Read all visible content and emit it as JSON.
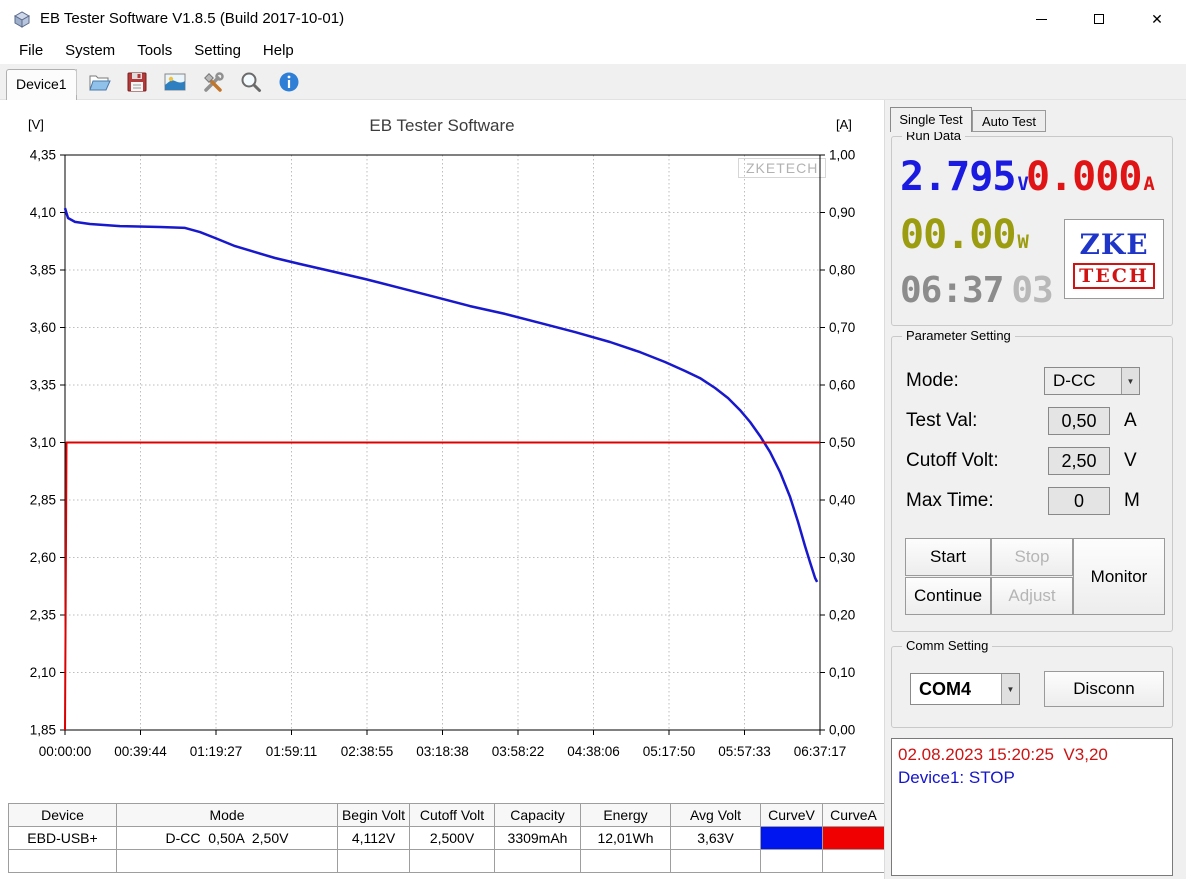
{
  "window": {
    "title": "EB Tester Software V1.8.5 (Build 2017-10-01)",
    "control_icons": [
      "minimize-icon",
      "maximize-icon",
      "close-icon"
    ]
  },
  "menu": {
    "items": [
      "File",
      "System",
      "Tools",
      "Setting",
      "Help"
    ]
  },
  "toolbar": {
    "device_tab": "Device1",
    "icons": [
      "open-file-icon",
      "save-icon",
      "export-image-icon",
      "tools-icon",
      "zoom-icon",
      "info-icon"
    ]
  },
  "chart_data": {
    "type": "line",
    "title": "EB Tester Software",
    "watermark": "ZKETECH",
    "xlim": [
      0,
      6.6214
    ],
    "x_ticks": [
      "00:00:00",
      "00:39:44",
      "01:19:27",
      "01:59:11",
      "02:38:55",
      "03:18:38",
      "03:58:22",
      "04:38:06",
      "05:17:50",
      "05:57:33",
      "06:37:17"
    ],
    "left_axis": {
      "unit": "[V]",
      "lim": [
        1.85,
        4.35
      ],
      "ticks": [
        "4,35",
        "4,10",
        "3,85",
        "3,60",
        "3,35",
        "3,10",
        "2,85",
        "2,60",
        "2,35",
        "2,10",
        "1,85"
      ]
    },
    "right_axis": {
      "unit": "[A]",
      "lim": [
        0.0,
        1.0
      ],
      "ticks": [
        "1,00",
        "0,90",
        "0,80",
        "0,70",
        "0,60",
        "0,50",
        "0,40",
        "0,30",
        "0,20",
        "0,10",
        "0,00"
      ]
    },
    "grid": "dotted",
    "series": [
      {
        "name": "Voltage",
        "axis": "left",
        "color": "#1818cc",
        "x": [
          0,
          0.026,
          0.088,
          0.219,
          0.482,
          0.833,
          1.052,
          1.184,
          1.316,
          1.491,
          1.666,
          1.842,
          2.061,
          2.324,
          2.631,
          2.938,
          3.245,
          3.552,
          3.859,
          4.166,
          4.473,
          4.78,
          5.043,
          5.262,
          5.438,
          5.569,
          5.701,
          5.815,
          5.92,
          6.008,
          6.096,
          6.183,
          6.271,
          6.359,
          6.429,
          6.49,
          6.534,
          6.578,
          6.596
        ],
        "y": [
          4.119,
          4.076,
          4.059,
          4.05,
          4.041,
          4.037,
          4.033,
          4.015,
          3.989,
          3.954,
          3.928,
          3.902,
          3.876,
          3.846,
          3.811,
          3.772,
          3.733,
          3.693,
          3.659,
          3.62,
          3.58,
          3.537,
          3.493,
          3.45,
          3.411,
          3.38,
          3.337,
          3.293,
          3.241,
          3.189,
          3.128,
          3.059,
          2.972,
          2.863,
          2.754,
          2.65,
          2.58,
          2.511,
          2.494
        ]
      },
      {
        "name": "Current",
        "axis": "right",
        "color": "#dd0000",
        "x": [
          0,
          0.013,
          6.6214
        ],
        "y": [
          0,
          0.5,
          0.5
        ]
      }
    ]
  },
  "side_panel": {
    "tabs": [
      {
        "label": "Single Test",
        "active": true
      },
      {
        "label": "Auto Test",
        "active": false
      }
    ],
    "run_data": {
      "label": "Run Data",
      "voltage": "2.795",
      "voltage_unit": "V",
      "current": "0.000",
      "current_unit": "A",
      "power": "00.00",
      "power_unit": "W",
      "time_main": "06:37",
      "time_sec": "03",
      "logo_top": "ZKE",
      "logo_bottom": "TECH",
      "colors": {
        "voltage": "#1a1ae0",
        "current": "#e01414",
        "power": "#9c9c10",
        "time": "#8c8c8c",
        "time_sec": "#b8b8b8"
      }
    },
    "parameter_setting": {
      "label": "Parameter Setting",
      "mode_label": "Mode:",
      "mode_value": "D-CC",
      "test_val_label": "Test Val:",
      "test_val_value": "0,50",
      "test_val_unit": "A",
      "cutoff_label": "Cutoff Volt:",
      "cutoff_value": "2,50",
      "cutoff_unit": "V",
      "max_time_label": "Max Time:",
      "max_time_value": "0",
      "max_time_unit": "M",
      "start": "Start",
      "stop": "Stop",
      "continue": "Continue",
      "adjust": "Adjust",
      "monitor": "Monitor"
    },
    "comm_setting": {
      "label": "Comm Setting",
      "port": "COM4",
      "disconnect": "Disconn"
    },
    "log": {
      "line1": "02.08.2023 15:20:25  V3,20",
      "line2": "Device1: STOP"
    }
  },
  "table": {
    "headers": [
      "Device",
      "Mode",
      "Begin Volt",
      "Cutoff Volt",
      "Capacity",
      "Energy",
      "Avg Volt",
      "CurveV",
      "CurveA"
    ],
    "row": {
      "device": "EBD-USB+",
      "mode": "D-CC  0,50A  2,50V",
      "begin_volt": "4,112V",
      "cutoff_volt": "2,500V",
      "capacity": "3309mAh",
      "energy": "12,01Wh",
      "avg_volt": "3,63V",
      "curve_v_color": "#0016f0",
      "curve_a_color": "#f00000"
    }
  }
}
